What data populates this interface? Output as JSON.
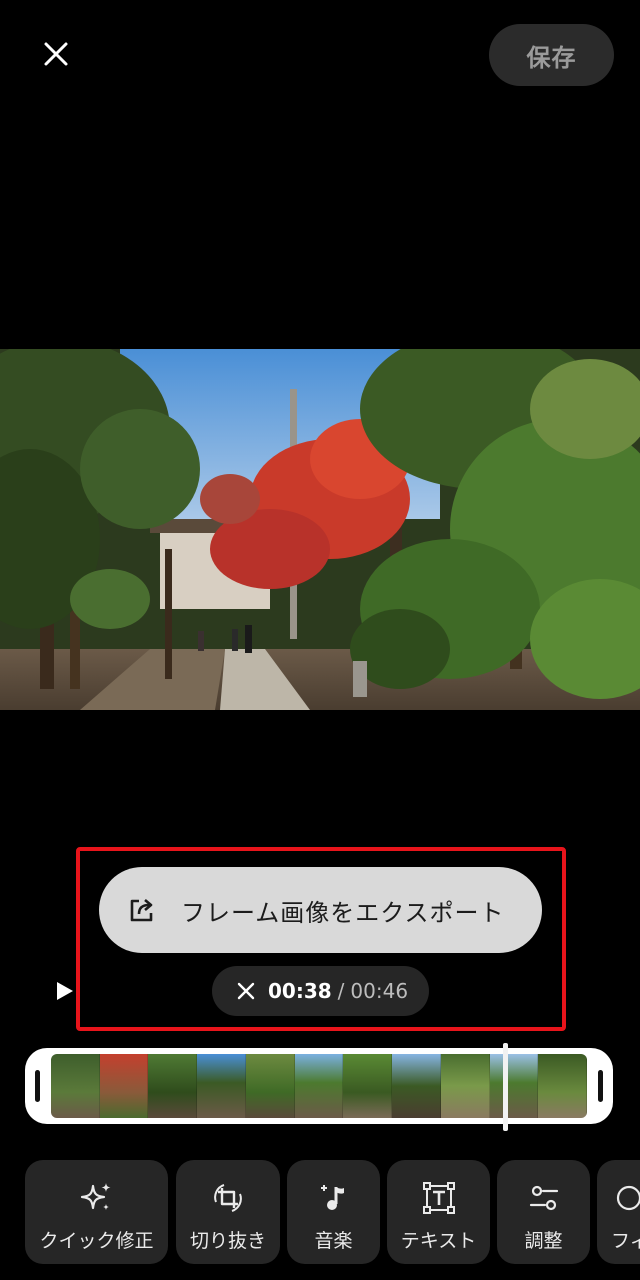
{
  "header": {
    "close_icon": "close-icon",
    "save_label": "保存"
  },
  "export": {
    "icon": "share-export-icon",
    "label": "フレーム画像をエクスポート"
  },
  "time": {
    "current": "00:38",
    "separator": "/",
    "total": "00:46",
    "close_icon": "close-icon"
  },
  "play_icon": "play-icon",
  "tools": [
    {
      "icon": "sparkle-icon",
      "label": "クイック修正"
    },
    {
      "icon": "crop-rotate-icon",
      "label": "切り抜き"
    },
    {
      "icon": "music-note-icon",
      "label": "音楽"
    },
    {
      "icon": "text-icon",
      "label": "テキスト"
    },
    {
      "icon": "adjust-icon",
      "label": "調整"
    },
    {
      "icon": "filter-icon",
      "label": "フィ"
    }
  ],
  "colors": {
    "highlight": "#e8141b",
    "background": "#000000",
    "pill": "#d9d9d9"
  }
}
